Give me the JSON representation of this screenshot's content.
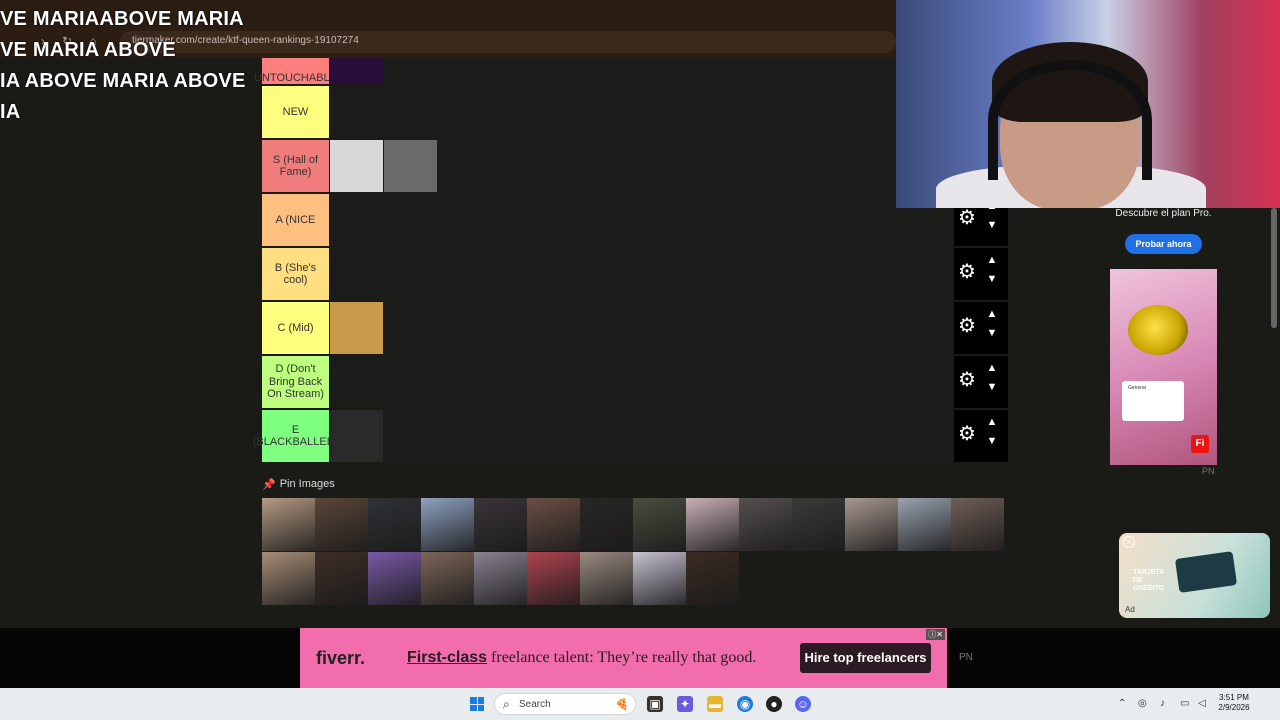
{
  "browser": {
    "url": "tiermaker.com/create/ktf-queen-rankings-19107274"
  },
  "overlay_text": {
    "lines": [
      "VE MARIAABOVE MARIA",
      "VE MARIA ABOVE",
      "IA ABOVE MARIA ABOVE",
      "IA"
    ]
  },
  "tiers": [
    {
      "label": "UNTOUCHABLE",
      "color": "#ff7f7f",
      "items": [
        "#2a0d3a"
      ]
    },
    {
      "label": "NEW",
      "color": "#ffff7f",
      "items": []
    },
    {
      "label": "S (Hall of Fame)",
      "color": "#f07c7c",
      "items": [
        "#d8d8d8",
        "#6a6a6a"
      ]
    },
    {
      "label": "A (NICE",
      "color": "#ffbf7f",
      "items": []
    },
    {
      "label": "B (She's cool)",
      "color": "#ffdf7f",
      "items": []
    },
    {
      "label": "C (Mid)",
      "color": "#ffff7f",
      "items": [
        "#c89a4a"
      ]
    },
    {
      "label": "D (Don't Bring Back On Stream)",
      "color": "#bfff7f",
      "items": []
    },
    {
      "label": "E (BLACKBALLED)",
      "color": "#7fff7f",
      "items": [
        "#2a2a2a"
      ]
    }
  ],
  "pin_images": {
    "label": "Pin Images",
    "rows": [
      [
        "#b59a83",
        "#5a4638",
        "#2e3236",
        "#8fa2c2",
        "#3a3438",
        "#6a4f44",
        "#2a2628",
        "#4a4e3e",
        "#c8b0b8",
        "#55504e",
        "#3a3a3a",
        "#a89890",
        "#9aa2b0",
        "#6e5e56"
      ],
      [
        "#a88d78",
        "#3d2e27",
        "#7a5aa8",
        "#7d6658",
        "#8a8290",
        "#b04450",
        "#9a8a80",
        "#c7c3d2",
        "#3a2b22"
      ]
    ]
  },
  "right_ad": {
    "text": "Descubre el plan Pro.",
    "button": "Probar ahora",
    "badge": "Fi",
    "pn": "PN",
    "card_text": "Generar"
  },
  "video_ad": {
    "title": "TARJETA DE CRÉDITO",
    "ad": "Ad"
  },
  "banner": {
    "logo": "fiverr.",
    "tagline_bold": "First-class",
    "tagline_rest": " freelance talent: They’re really that good.",
    "cta": "Hire top freelancers",
    "pn": "PN"
  },
  "taskbar": {
    "search_label": "Search",
    "time": "3:51 PM",
    "date": "2/9/2026"
  }
}
